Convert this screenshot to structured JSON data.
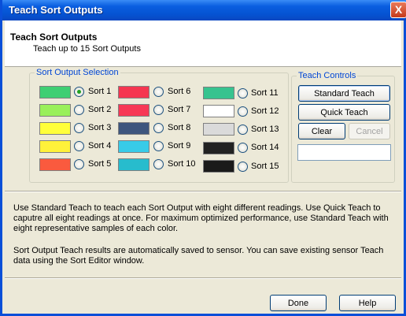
{
  "window": {
    "title": "Teach Sort Outputs",
    "close_glyph": "X"
  },
  "header": {
    "title": "Teach Sort Outputs",
    "subtitle": "Teach up to 15 Sort Outputs"
  },
  "sort_selection": {
    "legend": "Sort Output Selection",
    "selected": "Sort 1",
    "items": [
      {
        "label": "Sort 1",
        "color": "#3fcf73"
      },
      {
        "label": "Sort 2",
        "color": "#99f05a"
      },
      {
        "label": "Sort 3",
        "color": "#ffff3a"
      },
      {
        "label": "Sort 4",
        "color": "#fff13a"
      },
      {
        "label": "Sort 5",
        "color": "#fa5a3e"
      },
      {
        "label": "Sort 6",
        "color": "#f53650"
      },
      {
        "label": "Sort 7",
        "color": "#f73855"
      },
      {
        "label": "Sort 8",
        "color": "#3e567e"
      },
      {
        "label": "Sort 9",
        "color": "#38cbe8"
      },
      {
        "label": "Sort 10",
        "color": "#27bccd"
      },
      {
        "label": "Sort 11",
        "color": "#37c38f"
      },
      {
        "label": "Sort 12",
        "color": "#ffffff"
      },
      {
        "label": "Sort 13",
        "color": "#dadada"
      },
      {
        "label": "Sort 14",
        "color": "#222222"
      },
      {
        "label": "Sort 15",
        "color": "#1a1a1a"
      }
    ]
  },
  "teach_controls": {
    "legend": "Teach Controls",
    "standard_label": "Standard Teach",
    "quick_label": "Quick Teach",
    "clear_label": "Clear",
    "cancel_label": "Cancel",
    "status_value": ""
  },
  "info": {
    "paragraph1": "Use Standard Teach to teach each Sort Output with eight different readings. Use Quick Teach to caputre all eight readings at once. For maximum optimized performance, use Standard Teach with eight representative samples of each color.",
    "paragraph2": "Sort Output Teach results are automatically saved to sensor.  You can save existing sensor Teach data using the Sort Editor window."
  },
  "footer": {
    "done_label": "Done",
    "help_label": "Help"
  }
}
